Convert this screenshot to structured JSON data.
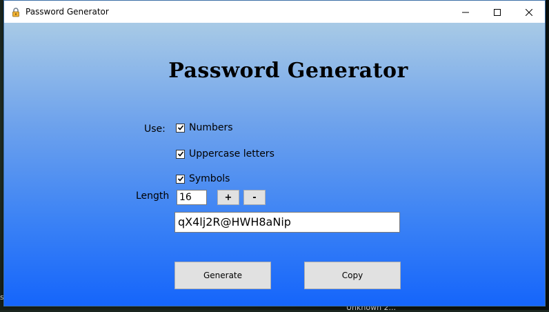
{
  "window": {
    "title": "Password Generator",
    "icon": "lock-icon",
    "controls": {
      "minimize_icon": "minimize-icon",
      "maximize_icon": "maximize-icon",
      "close_icon": "close-icon"
    }
  },
  "main": {
    "heading": "Password Generator",
    "use_label": "Use:",
    "options": [
      {
        "label": "Numbers",
        "checked": true
      },
      {
        "label": "Uppercase letters",
        "checked": true
      },
      {
        "label": "Symbols",
        "checked": true
      }
    ],
    "length_label": "Length",
    "length_value": "16",
    "increment_label": "+",
    "decrement_label": "-",
    "password_value": "qX4lj2R@HWH8aNip",
    "generate_label": "Generate",
    "copy_label": "Copy"
  },
  "desktop": {
    "taskbar_text": "Unknown 2...",
    "edge_text": "s"
  },
  "colors": {
    "gradient_top": "#a8cae6",
    "gradient_bottom": "#1565fb",
    "button_face": "#e1e1e1"
  }
}
